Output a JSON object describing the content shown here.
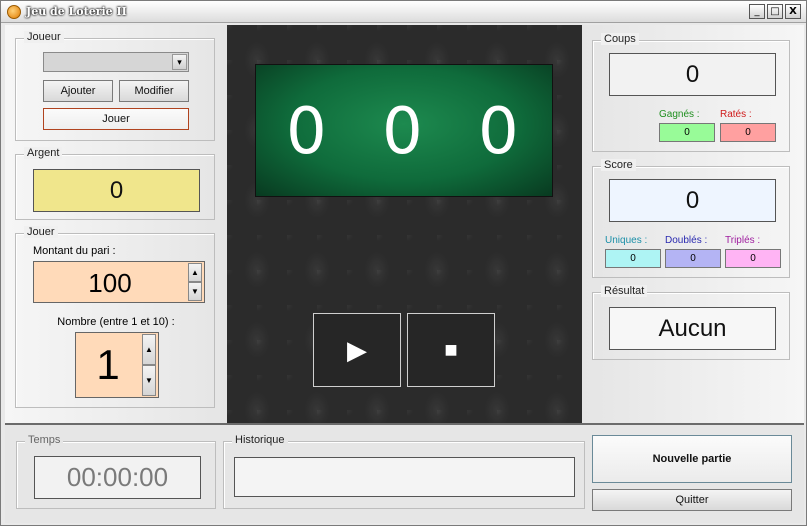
{
  "window": {
    "title": "Jeu de Loterie II",
    "minimize_glyph": "_",
    "maximize_glyph": "□",
    "close_glyph": "X"
  },
  "joueur": {
    "legend": "Joueur",
    "combo_value": "",
    "dropdown_glyph": "▾",
    "add_label": "Ajouter",
    "edit_label": "Modifier",
    "play_label": "Jouer"
  },
  "argent": {
    "legend": "Argent",
    "value": "0"
  },
  "jouer": {
    "legend": "Jouer",
    "bet_label": "Montant du pari :",
    "bet_value": "100",
    "number_label": "Nombre (entre 1 et 10) :",
    "number_value": "1",
    "spin_up": "▲",
    "spin_down": "▼"
  },
  "display": {
    "digits": [
      "0",
      "0",
      "0"
    ],
    "play_glyph": "▶",
    "stop_glyph": "■"
  },
  "coups": {
    "legend": "Coups",
    "value": "0",
    "won_label": "Gagnés :",
    "won_value": "0",
    "lost_label": "Ratés :",
    "lost_value": "0"
  },
  "score": {
    "legend": "Score",
    "value": "0",
    "single_label": "Uniques :",
    "single_value": "0",
    "double_label": "Doublés :",
    "double_value": "0",
    "triple_label": "Triplés :",
    "triple_value": "0"
  },
  "resultat": {
    "legend": "Résultat",
    "value": "Aucun"
  },
  "temps": {
    "legend": "Temps",
    "value": "00:00:00"
  },
  "historique": {
    "legend": "Historique",
    "value": ""
  },
  "actions": {
    "new_game_label": "Nouvelle partie",
    "quit_label": "Quitter"
  },
  "colors": {
    "argent_bg": "#f0e68c",
    "bet_bg": "#ffdab9",
    "won_bg": "#98fb98",
    "lost_bg": "#ffa0a0",
    "single_bg": "#aef4f4",
    "double_bg": "#b4b4f4",
    "triple_bg": "#ffb4f4",
    "score_bg": "#eef5ff",
    "felt_green": "#0f6b3b"
  }
}
